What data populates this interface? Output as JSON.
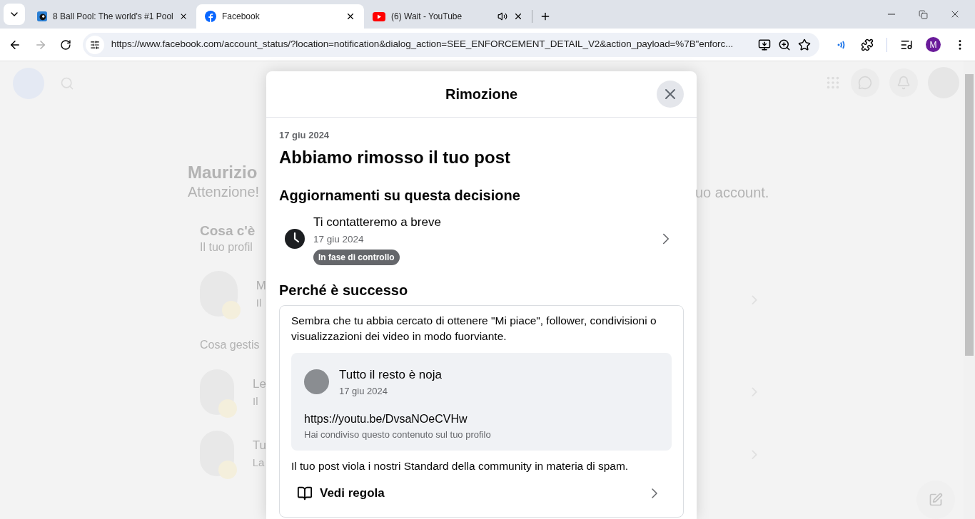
{
  "browser": {
    "tabs": [
      {
        "title": "8 Ball Pool: The world's #1 Pool",
        "kind": "game",
        "selected": false,
        "audio": false
      },
      {
        "title": "Facebook",
        "kind": "facebook",
        "selected": true,
        "audio": false
      },
      {
        "title": "(6) Wait - YouTube",
        "kind": "youtube",
        "selected": false,
        "audio": true
      }
    ],
    "url": "https://www.facebook.com/account_status/?location=notification&dialog_action=SEE_ENFORCEMENT_DETAIL_V2&action_payload=%7B\"enforc...",
    "profile_initial": "M"
  },
  "background": {
    "name": "Maurizio",
    "warning": "Attenzione!",
    "warning_end": "uo account.",
    "section": "Cosa c'è",
    "section_sub": "Il tuo profil",
    "items": [
      {
        "line_1": "M",
        "line_2": "Il"
      }
    ],
    "manage_heading": "Cosa gestis",
    "managed": [
      {
        "line_1": "Le",
        "line_2": "Il"
      },
      {
        "line_1": "Tu",
        "line_2": "La"
      }
    ]
  },
  "modal": {
    "title": "Rimozione",
    "date": "17 giu 2024",
    "heading": "Abbiamo rimosso il tuo post",
    "updates_heading": "Aggiornamenti su questa decisione",
    "update": {
      "title": "Ti contatteremo a breve",
      "date": "17 giu 2024",
      "status": "In fase di controllo"
    },
    "why_heading": "Perché è successo",
    "explanation": "Sembra che tu abbia cercato di ottenere \"Mi piace\", follower, condivisioni o visualizzazioni dei video in modo fuorviante.",
    "post": {
      "author": "Tutto il resto è noja",
      "date": "17 giu 2024",
      "link": "https://youtu.be/DvsaNOeCVHw",
      "note": "Hai condiviso questo contenuto sul tuo profilo"
    },
    "violation": "Il tuo post viola i nostri Standard della community in materia di spam.",
    "rule_link": "Vedi regola"
  }
}
